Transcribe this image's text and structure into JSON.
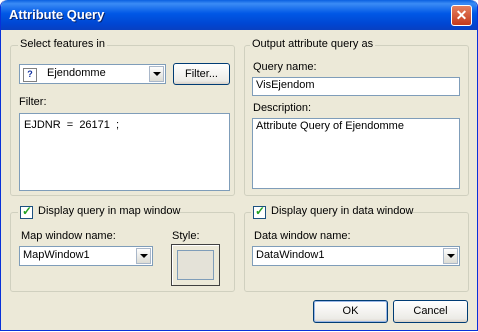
{
  "window": {
    "title": "Attribute Query",
    "close_icon": "close-icon"
  },
  "select_group": {
    "legend": "Select features in",
    "layer_value": "Ejendomme",
    "filter_button": "Filter...",
    "filter_label": "Filter:",
    "filter_text": "EJDNR  =  26171  ;"
  },
  "output_group": {
    "legend": "Output attribute query as",
    "query_name_label": "Query name:",
    "query_name_value": "VisEjendom",
    "description_label": "Description:",
    "description_value": "Attribute Query of Ejendomme"
  },
  "map_group": {
    "checkbox_label": "Display query in map window",
    "checked": true,
    "map_window_label": "Map window name:",
    "map_window_value": "MapWindow1",
    "style_label": "Style:"
  },
  "data_group": {
    "checkbox_label": "Display query in data window",
    "checked": true,
    "data_window_label": "Data window name:",
    "data_window_value": "DataWindow1"
  },
  "buttons": {
    "ok": "OK",
    "cancel": "Cancel"
  }
}
